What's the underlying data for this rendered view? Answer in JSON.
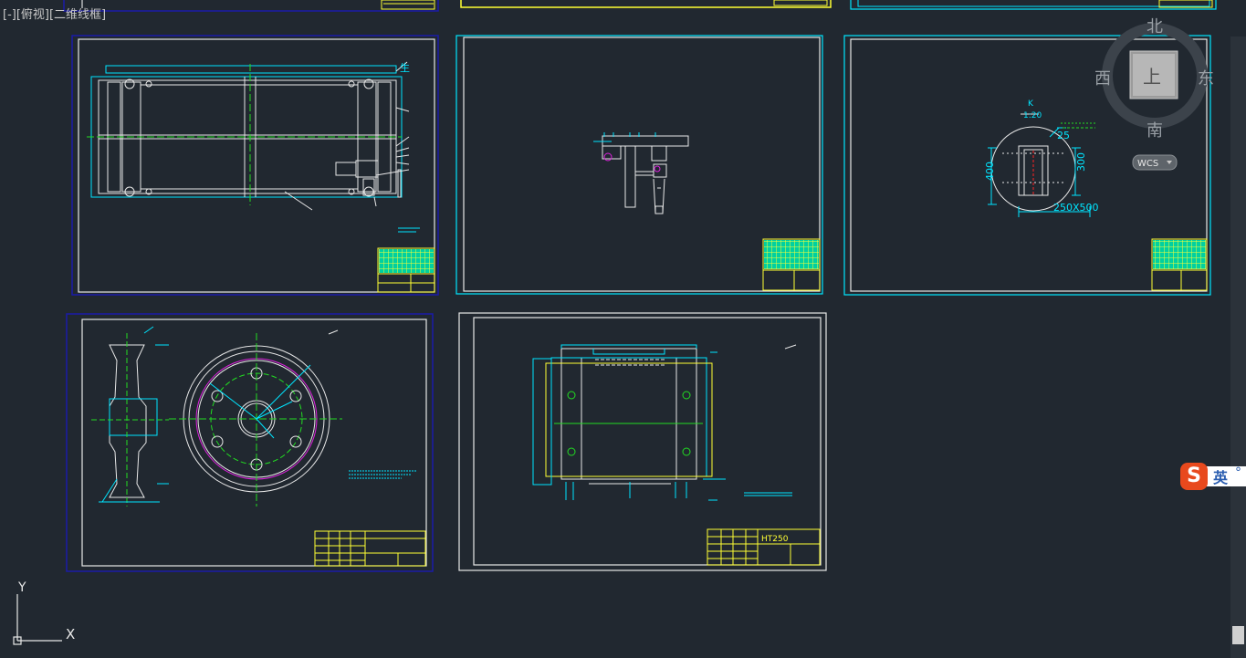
{
  "viewport": {
    "label": "[-][俯视][二维线框]"
  },
  "viewcube": {
    "north": "北",
    "south": "南",
    "east": "东",
    "west": "西",
    "face": "上",
    "wcs_label": "WCS"
  },
  "ucs_icon": {
    "x_label": "X",
    "y_label": "Y"
  },
  "drawings": {
    "detail_sheet": {
      "scale_label": "K",
      "scale_value": "1:20",
      "dim_25": "25",
      "dim_300": "300",
      "dim_400": "400",
      "dim_250x500": "250X500"
    },
    "housing_sheet": {
      "material": "HT250"
    }
  },
  "ime": {
    "logo": "S",
    "mode": "英",
    "extra": "°"
  },
  "colors": {
    "background": "#212830",
    "line_cyan": "#00e5ff",
    "line_white": "#e8e8e8",
    "line_yellow": "#ffff33",
    "line_green": "#22dd22",
    "line_magenta": "#dd22dd",
    "frame_blue": "#1a1aa8"
  }
}
